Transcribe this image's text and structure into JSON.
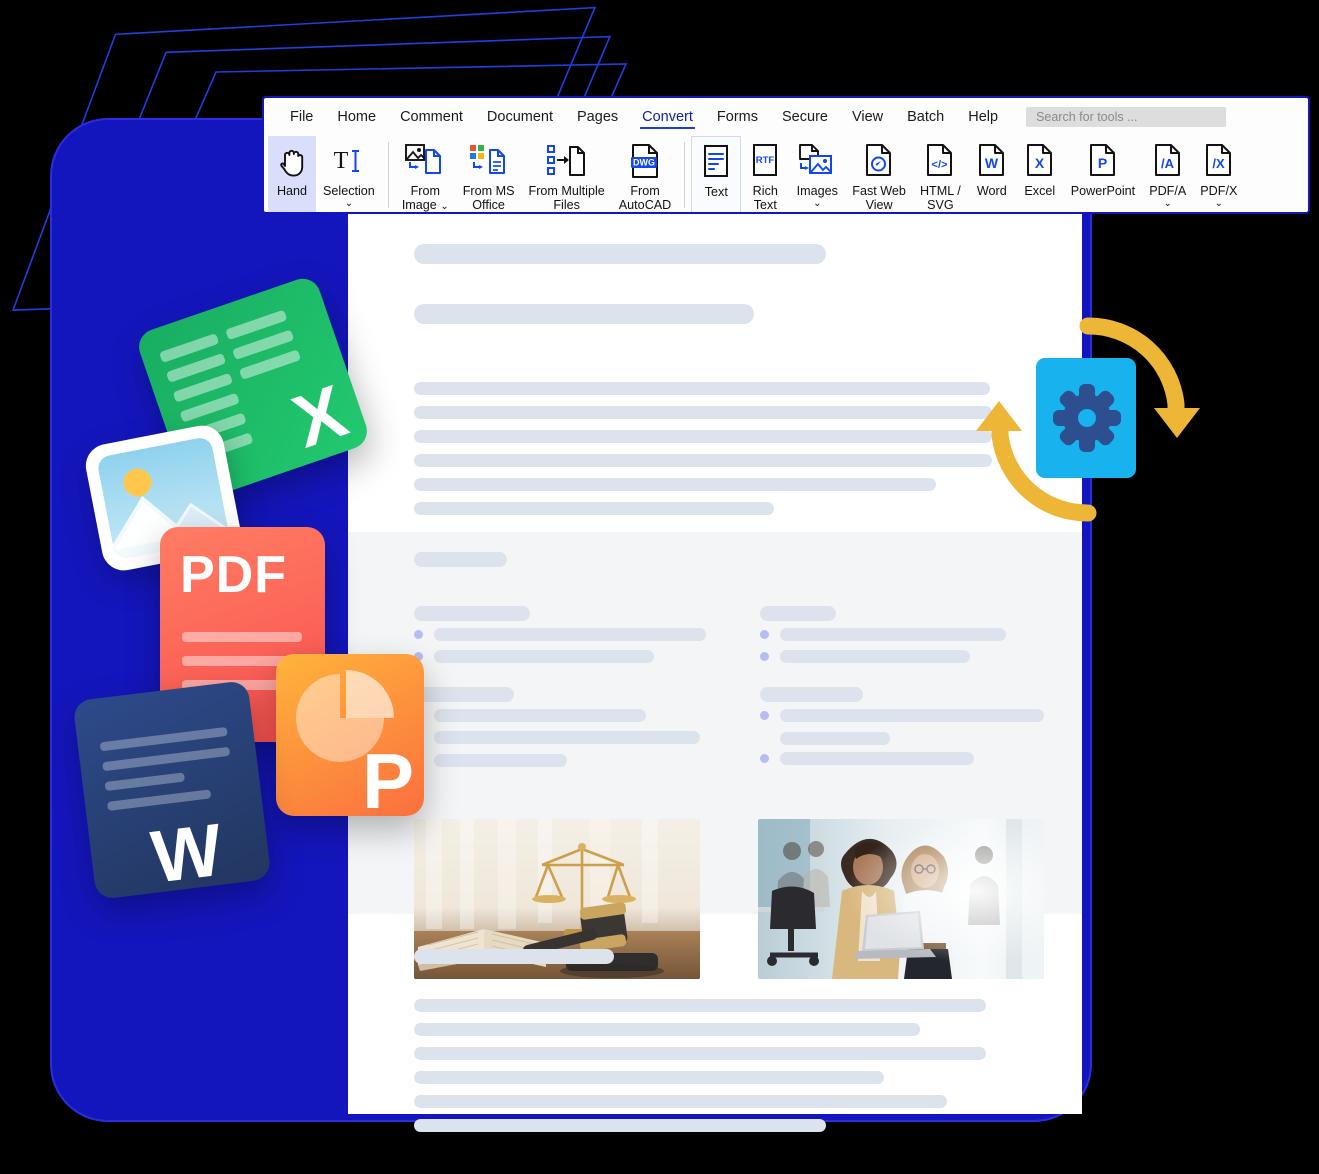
{
  "app": {
    "ribbon": {
      "menu_items": [
        {
          "label": "File",
          "active": false
        },
        {
          "label": "Home",
          "active": false
        },
        {
          "label": "Comment",
          "active": false
        },
        {
          "label": "Document",
          "active": false
        },
        {
          "label": "Pages",
          "active": false
        },
        {
          "label": "Convert",
          "active": true
        },
        {
          "label": "Forms",
          "active": false
        },
        {
          "label": "Secure",
          "active": false
        },
        {
          "label": "View",
          "active": false
        },
        {
          "label": "Batch",
          "active": false
        },
        {
          "label": "Help",
          "active": false
        }
      ],
      "search": {
        "placeholder": "Search for tools ...",
        "value": ""
      },
      "tools": [
        {
          "label": "Hand",
          "icon": "hand-icon",
          "caret": false,
          "state": "selected"
        },
        {
          "label": "Selection",
          "icon": "text-selection-icon",
          "caret": true,
          "state": "normal"
        },
        {
          "label": "From\nImage",
          "icon": "from-image-icon",
          "caret": "inline",
          "state": "normal"
        },
        {
          "label": "From MS\nOffice",
          "icon": "from-ms-office-icon",
          "caret": false,
          "state": "normal"
        },
        {
          "label": "From Multiple\nFiles",
          "icon": "from-multiple-files-icon",
          "caret": false,
          "state": "normal"
        },
        {
          "label": "From\nAutoCAD",
          "icon": "from-autocad-dwg-icon",
          "caret": false,
          "state": "normal"
        },
        {
          "label": "Text",
          "icon": "text-file-icon",
          "caret": false,
          "state": "boxed"
        },
        {
          "label": "Rich\nText",
          "icon": "rtf-file-icon",
          "caret": false,
          "state": "normal"
        },
        {
          "label": "Images",
          "icon": "to-images-icon",
          "caret": true,
          "state": "normal"
        },
        {
          "label": "Fast Web\nView",
          "icon": "fast-web-view-icon",
          "caret": false,
          "state": "normal"
        },
        {
          "label": "HTML /\nSVG",
          "icon": "html-svg-icon",
          "caret": false,
          "state": "normal"
        },
        {
          "label": "Word",
          "icon": "word-file-icon",
          "caret": false,
          "state": "normal"
        },
        {
          "label": "Excel",
          "icon": "excel-file-icon",
          "caret": false,
          "state": "normal"
        },
        {
          "label": "PowerPoint",
          "icon": "powerpoint-file-icon",
          "caret": false,
          "state": "normal"
        },
        {
          "label": "PDF/A",
          "icon": "pdf-a-file-icon",
          "caret": true,
          "state": "normal"
        },
        {
          "label": "PDF/X",
          "icon": "pdf-x-file-icon",
          "caret": true,
          "state": "normal"
        }
      ]
    }
  },
  "document": {
    "images": [
      {
        "name": "gavel-scales-law-photo",
        "alt": "Gavel, scales of justice and open law book"
      },
      {
        "name": "two-women-with-laptop-office-photo",
        "alt": "Two businesswomen looking at a laptop in an office"
      }
    ]
  },
  "file_cards": [
    {
      "name": "excel-file-card",
      "letter": "X",
      "color": "#21c46c"
    },
    {
      "name": "image-file-card",
      "letter": "",
      "color": "#ffffff"
    },
    {
      "name": "pdf-file-card",
      "letter": "PDF",
      "color": "#fb5a52"
    },
    {
      "name": "powerpoint-file-card",
      "letter": "P",
      "color": "#fb7a3d"
    },
    {
      "name": "word-file-card",
      "letter": "W",
      "color": "#27406f"
    }
  ],
  "convert_badge": {
    "name": "convert-cycle-badge",
    "doc_color": "#18b2ef",
    "gear_color": "#2d4f8f",
    "arrow_color": "#eeb637"
  },
  "colors": {
    "frame_blue": "#1416bd",
    "accent_blue": "#1b3fd6",
    "ribbon_bg": "#fdfdfd",
    "selected_tool_bg": "#d9dffa",
    "placeholder_gray": "#dde3ed",
    "band_gray": "#f4f5f7",
    "bullet_purple": "#b6bdf0"
  }
}
